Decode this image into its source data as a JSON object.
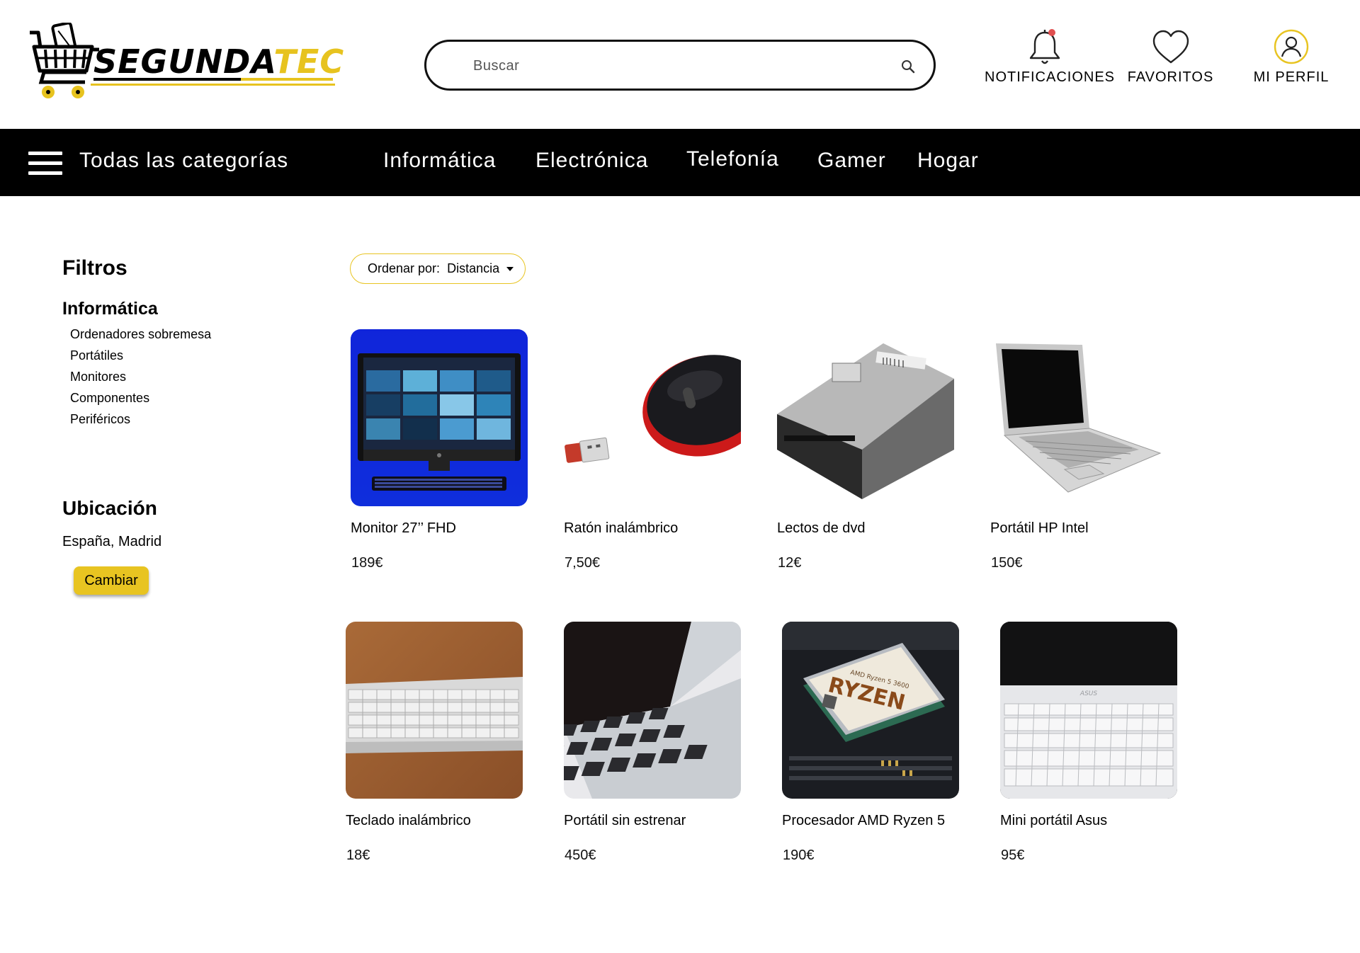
{
  "brand": {
    "name_main": "SEGUNDA",
    "name_accent": "TEC",
    "accent_color": "#e7c31f"
  },
  "search": {
    "placeholder": "Buscar"
  },
  "header_actions": {
    "notifications": "NOTIFICACIONES",
    "favorites": "FAVORITOS",
    "profile": "MI PERFIL"
  },
  "nav": {
    "all_categories": "Todas las categorías",
    "links": [
      "Informática",
      "Electrónica",
      "Telefonía",
      "Gamer",
      "Hogar"
    ]
  },
  "filters": {
    "title": "Filtros",
    "category": "Informática",
    "subcategories": [
      "Ordenadores sobremesa",
      "Portátiles",
      "Monitores",
      "Componentes",
      "Periféricos"
    ],
    "location_title": "Ubicación",
    "location_value": "España, Madrid",
    "change_button": "Cambiar"
  },
  "sort": {
    "label": "Ordenar por:",
    "value": "Distancia"
  },
  "products": [
    {
      "name": "Monitor 27’’ FHD",
      "price": "189€",
      "image": "monitor-image"
    },
    {
      "name": "Ratón inalámbrico",
      "price": "7,50€",
      "image": "mouse-image"
    },
    {
      "name": "Lectos de dvd",
      "price": "12€",
      "image": "dvd-drive-image"
    },
    {
      "name": "Portátil HP Intel",
      "price": "150€",
      "image": "laptop-image"
    },
    {
      "name": "Teclado inalámbrico",
      "price": "18€",
      "image": "keyboard-image"
    },
    {
      "name": "Portátil sin estrenar",
      "price": "450€",
      "image": "laptop-keyboard-image"
    },
    {
      "name": "Procesador AMD Ryzen 5",
      "price": "190€",
      "image": "cpu-image"
    },
    {
      "name": "Mini portátil Asus",
      "price": "95€",
      "image": "asus-laptop-image"
    }
  ],
  "colors": {
    "nav_bg": "#000000",
    "accent": "#e8c421",
    "notification_dot": "#e05050"
  }
}
